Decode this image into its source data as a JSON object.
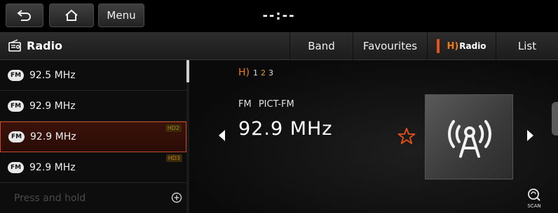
{
  "status_bar": {
    "back_icon": "back-arrow-icon",
    "home_icon": "home-icon",
    "menu_label": "Menu",
    "clock": "--:--"
  },
  "title_bar": {
    "icon": "radio-icon",
    "title": "Radio",
    "tabs": {
      "band": "Band",
      "favourites": "Favourites",
      "hd_radio": "Radio",
      "list": "List"
    },
    "hd_marker_color": "#e8501a"
  },
  "presets": [
    {
      "badge": "FM",
      "frequency": "92.5 MHz",
      "hd_channel": "",
      "selected": false
    },
    {
      "badge": "FM",
      "frequency": "92.9 MHz",
      "hd_channel": "",
      "selected": false
    },
    {
      "badge": "FM",
      "frequency": "92.9 MHz",
      "hd_channel": "HD2",
      "selected": true
    },
    {
      "badge": "FM",
      "frequency": "92.9 MHz",
      "hd_channel": "HD3",
      "selected": false
    }
  ],
  "preset_footer": {
    "hint": "Press and hold",
    "add_icon": "add-circle-icon"
  },
  "now_playing": {
    "hd_channels": [
      "1",
      "2",
      "3"
    ],
    "active_channel": "2",
    "band": "FM",
    "station_name": "PICT-FM",
    "frequency": "92.9 MHz",
    "favourite_icon": "star-outline-icon",
    "art_icon": "broadcast-tower-icon",
    "scan_label": "SCAN"
  },
  "colors": {
    "accent": "#e8501a",
    "hd_orange": "#f07a1a",
    "active_channel": "#f0a020"
  }
}
